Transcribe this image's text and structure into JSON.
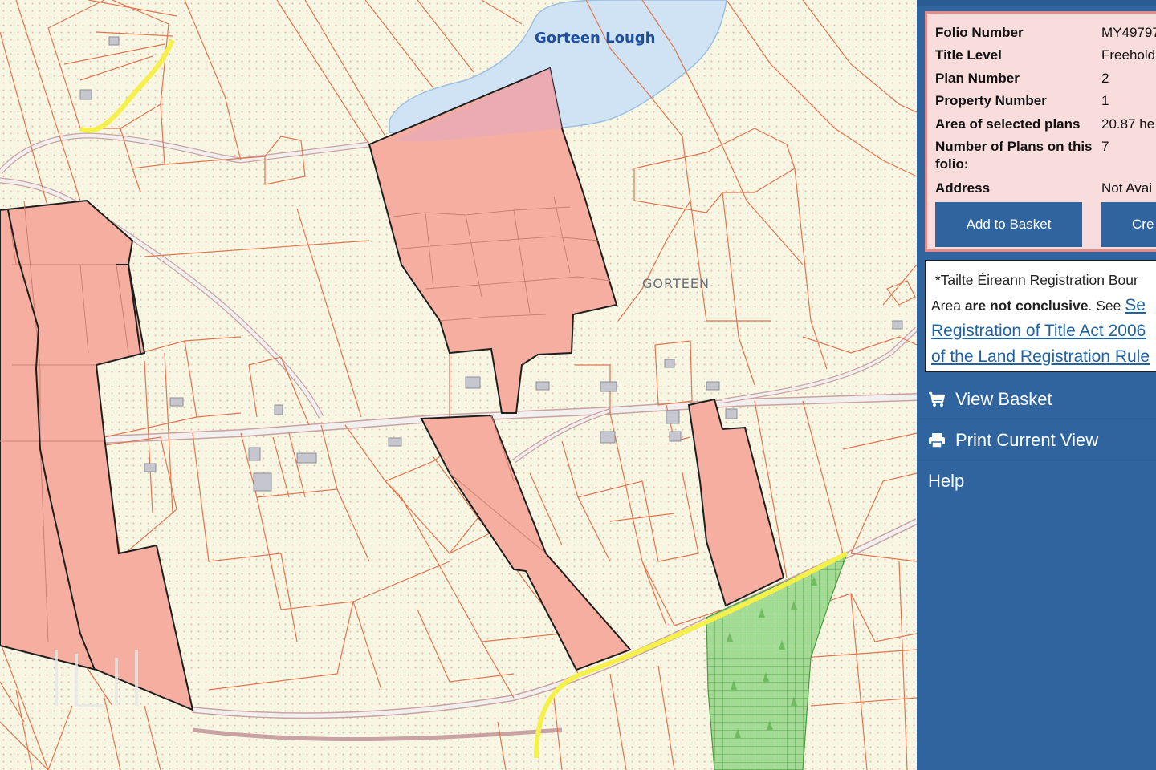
{
  "map": {
    "lake_label": "Gorteen Lough",
    "townland_label": "GORTEEN",
    "colors": {
      "land": "#f6f6e3",
      "parcel_boundary": "#e0764e",
      "selected_plan_fill": "#f5aea0",
      "selected_plan_outline": "#1e1e1e",
      "water": "#cfe3f5",
      "road": "#f2efef",
      "highlighted_road": "#f5f04a",
      "forestry": "#8fcf82"
    }
  },
  "folio_panel": {
    "rows": [
      {
        "label": "Folio Number",
        "value": "MY49797"
      },
      {
        "label": "Title Level",
        "value": "Freehold"
      },
      {
        "label": "Plan Number",
        "value": "2"
      },
      {
        "label": "Property Number",
        "value": "1"
      },
      {
        "label": "Area of selected plans",
        "value": "20.87 he"
      },
      {
        "label": "Number of Plans on this folio:",
        "value": "7"
      },
      {
        "label": "Address",
        "value": "Not Avai"
      }
    ],
    "add_to_basket_label": "Add to Basket",
    "create_label": "Cre"
  },
  "notice": {
    "line1": "*Tailte Éireann Registration Bour",
    "line2_prefix": "Area ",
    "line2_bold": "are not conclusive",
    "line2_suffix": ". See ",
    "link1": "Se",
    "link2": "Registration of Title Act 2006",
    "link3": "of the Land Registration Rule"
  },
  "menu": {
    "view_basket": "View Basket",
    "view_basket_icon": "cart-icon",
    "print_view": "Print Current View",
    "print_view_icon": "printer-icon",
    "help": "Help"
  }
}
